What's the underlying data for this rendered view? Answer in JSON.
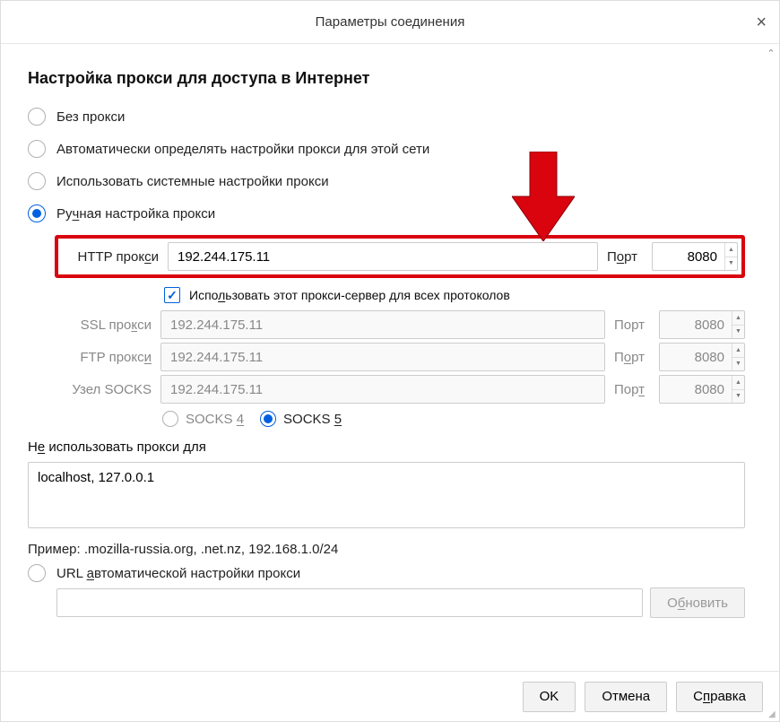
{
  "title": "Параметры соединения",
  "heading": "Настройка прокси для доступа в Интернет",
  "radios": {
    "none": "Без прокси",
    "auto": "Автоматически определять настройки прокси для этой сети",
    "system": "Использовать системные настройки прокси",
    "manual_pre": "Ру",
    "manual_u": "ч",
    "manual_post": "ная настройка прокси",
    "pac_pre": "URL ",
    "pac_u": "а",
    "pac_post": "втоматической настройки прокси"
  },
  "labels": {
    "http_pre": "HTTP прок",
    "http_u": "с",
    "http_post": "и",
    "ssl_pre": "SSL про",
    "ssl_u": "к",
    "ssl_post": "си",
    "ftp_pre": "FTP прокс",
    "ftp_u": "и",
    "socks": "Узел SOCKS",
    "port": "Порт",
    "port_u_pre": "П",
    "port_u_u": "о",
    "port_u_post": "рт",
    "port_u2_pre": "Пор",
    "port_u2_u": "т",
    "use_for_all_pre": "Испо",
    "use_for_all_u": "л",
    "use_for_all_post": "ьзовать этот прокси-сервер для всех протоколов",
    "socks4_pre": "SOCKS ",
    "socks4_u": "4",
    "socks5_pre": "SOCKS ",
    "socks5_u": "5",
    "noproxy_pre": "Н",
    "noproxy_u": "е",
    "noproxy_post": " использовать прокси для",
    "example": "Пример: .mozilla-russia.org, .net.nz, 192.168.1.0/24",
    "reload_pre": "О",
    "reload_u": "б",
    "reload_post": "новить"
  },
  "values": {
    "http_host": "192.244.175.11",
    "http_port": "8080",
    "ssl_host": "192.244.175.11",
    "ssl_port": "8080",
    "ftp_host": "192.244.175.11",
    "ftp_port": "8080",
    "socks_host": "192.244.175.11",
    "socks_port": "8080",
    "noproxy": "localhost, 127.0.0.1"
  },
  "buttons": {
    "ok": "OK",
    "cancel": "Отмена",
    "help_pre": "С",
    "help_u": "п",
    "help_post": "равка"
  }
}
